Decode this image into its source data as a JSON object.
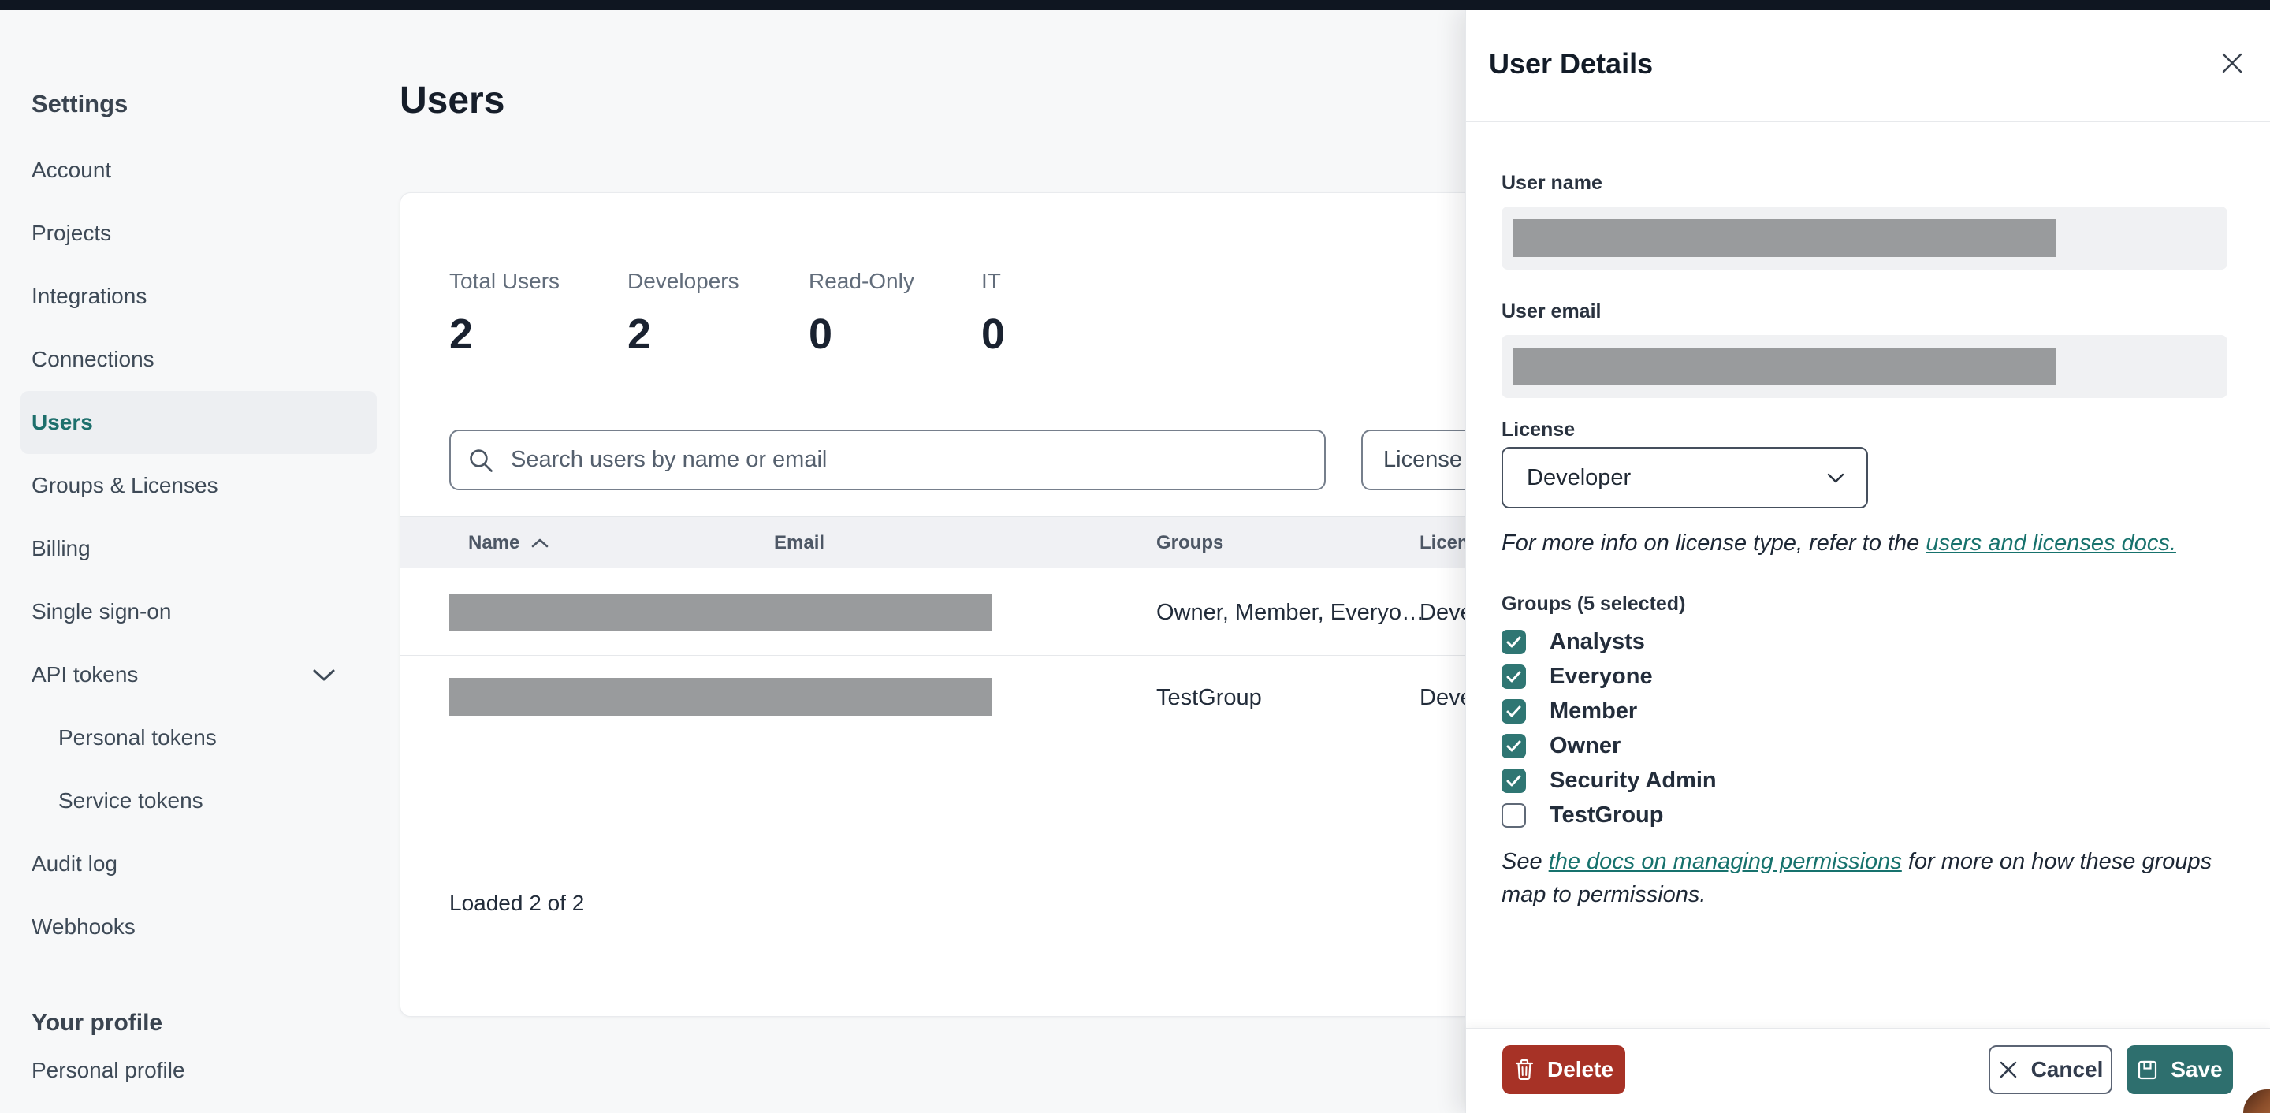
{
  "sidebar": {
    "heading": "Settings",
    "items": [
      {
        "label": "Account"
      },
      {
        "label": "Projects"
      },
      {
        "label": "Integrations"
      },
      {
        "label": "Connections"
      },
      {
        "label": "Users",
        "active": true
      },
      {
        "label": "Groups & Licenses"
      },
      {
        "label": "Billing"
      },
      {
        "label": "Single sign-on"
      },
      {
        "label": "API tokens",
        "has_chevron": true
      },
      {
        "label": "Personal tokens",
        "indented": true
      },
      {
        "label": "Service tokens",
        "indented": true
      },
      {
        "label": "Audit log"
      },
      {
        "label": "Webhooks"
      }
    ],
    "profile_heading": "Your profile",
    "profile_items": [
      {
        "label": "Personal profile"
      }
    ]
  },
  "main": {
    "title": "Users",
    "stats": [
      {
        "label": "Total Users",
        "value": "2"
      },
      {
        "label": "Developers",
        "value": "2"
      },
      {
        "label": "Read-Only",
        "value": "0"
      },
      {
        "label": "IT",
        "value": "0"
      }
    ],
    "search": {
      "placeholder": "Search users by name or email",
      "value": ""
    },
    "license_filter_label": "License",
    "table": {
      "columns": [
        "Name",
        "Email",
        "Groups",
        "License"
      ],
      "sorted_column": "Name",
      "sort_direction": "asc",
      "rows": [
        {
          "name_redacted": true,
          "email_redacted": true,
          "groups": "Owner, Member, Everyo…",
          "license": "Developer"
        },
        {
          "name_redacted": true,
          "email_redacted": true,
          "groups": "TestGroup",
          "license": "Developer"
        }
      ]
    },
    "footer_status": "Loaded 2 of 2"
  },
  "panel": {
    "title": "User Details",
    "fields": {
      "user_name_label": "User name",
      "user_name_redacted": true,
      "user_email_label": "User email",
      "user_email_redacted": true,
      "license_label": "License",
      "license_value": "Developer"
    },
    "license_note": {
      "prefix": "For more info on license type, refer to the ",
      "link": "users and licenses docs."
    },
    "groups": {
      "label": "Groups (5 selected)",
      "options": [
        {
          "label": "Analysts",
          "checked": true
        },
        {
          "label": "Everyone",
          "checked": true
        },
        {
          "label": "Member",
          "checked": true
        },
        {
          "label": "Owner",
          "checked": true
        },
        {
          "label": "Security Admin",
          "checked": true
        },
        {
          "label": "TestGroup",
          "checked": false
        }
      ]
    },
    "permissions_note": {
      "prefix": "See ",
      "link": "the docs on managing permissions",
      "suffix": " for more on how these groups map to permissions."
    },
    "actions": {
      "delete": "Delete",
      "cancel": "Cancel",
      "save": "Save"
    }
  },
  "colors": {
    "topbar": "#0F1621",
    "accent_teal": "#2E6F6E",
    "link_teal": "#17726D",
    "checkbox_teal": "#2F7673",
    "delete_red": "#A73226",
    "redaction_gray": "#999B9D",
    "page_bg": "#F7F8F9",
    "active_item_bg": "#EDEFF2"
  }
}
